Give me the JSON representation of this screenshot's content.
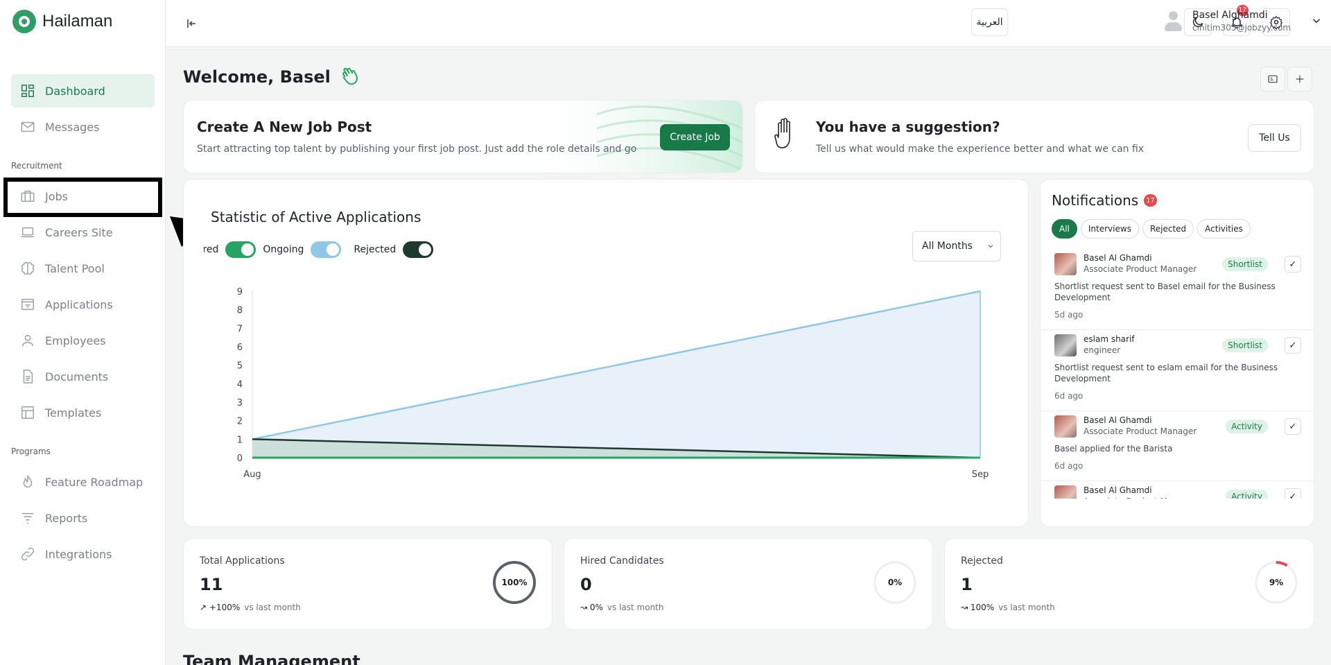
{
  "app": {
    "name": "Hailaman"
  },
  "sidebar": {
    "items_top": [
      {
        "label": "Dashboard",
        "icon": "dashboard-icon",
        "active": true
      },
      {
        "label": "Messages",
        "icon": "mail-icon"
      }
    ],
    "section_recruitment": "Recruitment",
    "items_recruitment": [
      {
        "label": "Jobs",
        "icon": "briefcase-icon"
      },
      {
        "label": "Careers Site",
        "icon": "laptop-icon"
      },
      {
        "label": "Talent Pool",
        "icon": "brain-icon"
      },
      {
        "label": "Applications",
        "icon": "inbox-icon"
      },
      {
        "label": "Employees",
        "icon": "user-icon"
      },
      {
        "label": "Documents",
        "icon": "document-icon"
      },
      {
        "label": "Templates",
        "icon": "layout-icon"
      }
    ],
    "section_programs": "Programs",
    "items_programs": [
      {
        "label": "Feature Roadmap",
        "icon": "flame-icon"
      },
      {
        "label": "Reports",
        "icon": "filter-icon"
      },
      {
        "label": "Integrations",
        "icon": "link-icon"
      }
    ]
  },
  "header": {
    "language_button": "العربية",
    "notification_count": "17",
    "user_name": "Basel Alghamdi",
    "user_email": "cihitim305@jobzyy.com"
  },
  "welcome": {
    "title": "Welcome, Basel"
  },
  "job_card": {
    "title": "Create A New Job Post",
    "subtitle": "Start attracting top talent by publishing your first job post. Just add the role details and go",
    "button": "Create Job"
  },
  "suggestion_card": {
    "title": "You have a suggestion?",
    "subtitle": "Tell us what would make the experience better and what we can fix",
    "button": "Tell Us"
  },
  "chart_card": {
    "title": "Statistic of Active Applications",
    "legend": [
      {
        "label": "Hired",
        "color": "#27a463"
      },
      {
        "label": "Ongoing",
        "color": "#8ec7e8"
      },
      {
        "label": "Rejected",
        "color": "#1e3a2f"
      }
    ],
    "month_select": "All Months"
  },
  "chart_data": {
    "type": "area",
    "categories": [
      "Aug",
      "Sep"
    ],
    "series": [
      {
        "name": "Hired",
        "values": [
          0,
          0
        ],
        "color": "#27a463"
      },
      {
        "name": "Ongoing",
        "values": [
          1,
          9
        ],
        "color": "#8ec7e8"
      },
      {
        "name": "Rejected",
        "values": [
          1,
          0
        ],
        "color": "#1e3a2f"
      }
    ],
    "yticks": [
      "0",
      "1",
      "2",
      "3",
      "4",
      "5",
      "6",
      "7",
      "8",
      "9"
    ],
    "ylim": [
      0,
      9
    ]
  },
  "notifications": {
    "title": "Notifications",
    "count": "17",
    "tabs": [
      "All",
      "Interviews",
      "Rejected",
      "Activities"
    ],
    "items": [
      {
        "name": "Basel Al Ghamdi",
        "role": "Associate Product Manager",
        "tag": "Shortlist",
        "message": "Shortlist request sent to Basel email for the Business Development",
        "time": "5d ago"
      },
      {
        "name": "eslam sharif",
        "role": "engineer",
        "tag": "Shortlist",
        "message": "Shortlist request sent to eslam email for the Business Development",
        "time": "6d ago"
      },
      {
        "name": "Basel Al Ghamdi",
        "role": "Associate Product Manager",
        "tag": "Activity",
        "message": "Basel applied for the Barista",
        "time": "6d ago"
      },
      {
        "name": "Basel Al Ghamdi",
        "role": "Associate Product Manager",
        "tag": "Activity",
        "message": "",
        "time": ""
      }
    ]
  },
  "stats": [
    {
      "label": "Total Applications",
      "value": "11",
      "trend": "+100%",
      "trend_suffix": "vs last month",
      "ring_text": "100%",
      "ring_fraction": 1.0,
      "ring_color": "#5c6166"
    },
    {
      "label": "Hired Candidates",
      "value": "0",
      "trend": "0%",
      "trend_suffix": "vs last month",
      "ring_text": "0%",
      "ring_fraction": 0.0,
      "ring_color": "#27a463"
    },
    {
      "label": "Rejected",
      "value": "1",
      "trend": "100%",
      "trend_suffix": "vs last month",
      "ring_text": "9%",
      "ring_fraction": 0.09,
      "ring_color": "#e5484d"
    }
  ],
  "team": {
    "title": "Team Management"
  }
}
